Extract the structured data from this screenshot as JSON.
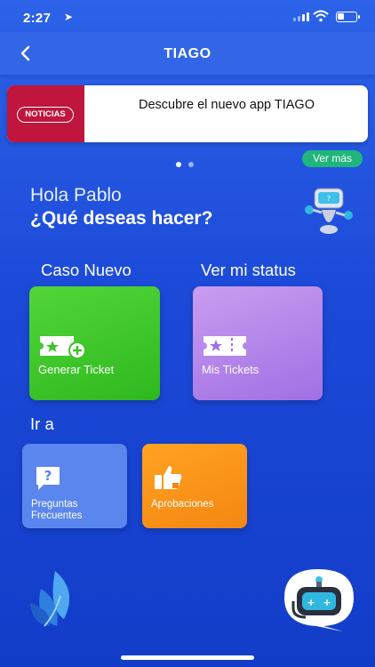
{
  "status_bar": {
    "time": "2:27"
  },
  "nav": {
    "title": "TIAGO"
  },
  "banner": {
    "logo_text": "NOTICIAS",
    "text": "Descubre el nuevo app TIAGO",
    "more_label": "Ver más"
  },
  "greeting": {
    "hello": "Hola Pablo",
    "question": "¿Qué deseas hacer?"
  },
  "sections": {
    "new_case": "Caso Nuevo",
    "status": "Ver mi status",
    "goto": "Ir a"
  },
  "cards": {
    "generate": "Generar Ticket",
    "tickets": "Mis Tickets",
    "faq": "Preguntas\nFrecuentes",
    "approvals": "Aprobaciones"
  },
  "colors": {
    "background": "#1f4fd6",
    "green": "#3cc42a",
    "purple": "#b286ea",
    "orange": "#f7921a",
    "badge": "#1fb57c",
    "news_red": "#c0153c"
  }
}
